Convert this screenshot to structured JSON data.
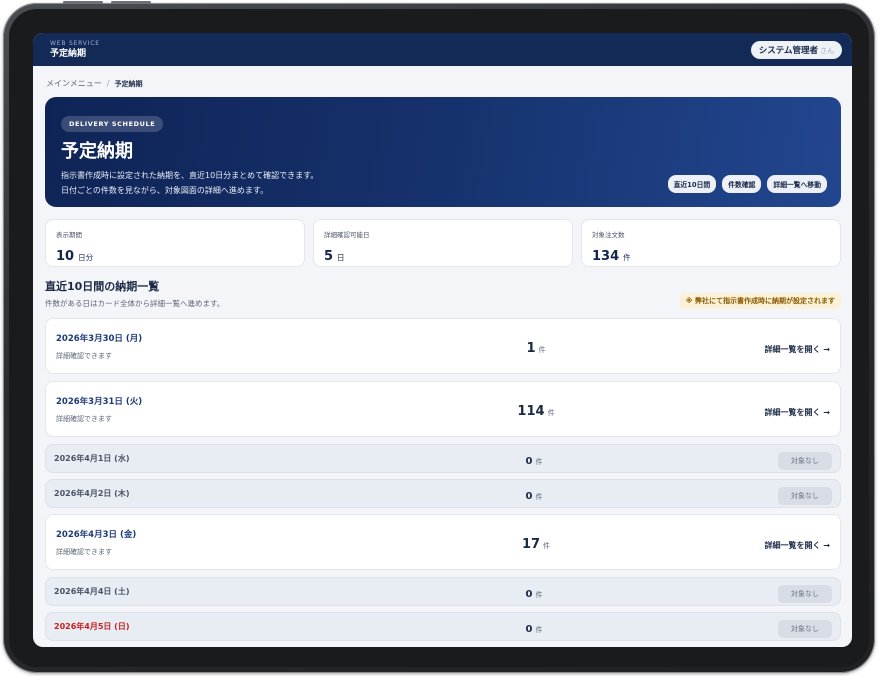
{
  "header": {
    "subtitle": "WEB SERVICE",
    "title": "予定納期",
    "user_name": "システム管理者",
    "user_suffix": "さん"
  },
  "breadcrumb": {
    "root": "メインメニュー",
    "separator": "/",
    "current": "予定納期"
  },
  "hero": {
    "tag": "DELIVERY SCHEDULE",
    "title": "予定納期",
    "desc_line1": "指示書作成時に設定された納期を、直近10日分まとめて確認できます。",
    "desc_line2": "日付ごとの件数を見ながら、対象図面の詳細へ進めます。",
    "buttons": [
      "直近10日間",
      "件数確認",
      "詳細一覧へ移動"
    ]
  },
  "stats": [
    {
      "label": "表示期間",
      "value": "10",
      "unit": "日分"
    },
    {
      "label": "詳細確認可能日",
      "value": "5",
      "unit": "日"
    },
    {
      "label": "対象注文数",
      "value": "134",
      "unit": "件"
    }
  ],
  "section": {
    "title": "直近10日間の納期一覧",
    "desc": "件数がある日はカード全体から詳細一覧へ進めます。",
    "notice": "※ 弊社にて指示書作成時に納期が設定されます"
  },
  "days": [
    {
      "date": "2026年3月30日 (月)",
      "count": "1",
      "unit": "件",
      "note": "詳細確認できます",
      "action": "詳細一覧を開く →"
    },
    {
      "date": "2026年3月31日 (火)",
      "count": "114",
      "unit": "件",
      "note": "詳細確認できます",
      "action": "詳細一覧を開く →"
    },
    {
      "date": "2026年4月1日 (水)",
      "count": "0",
      "unit": "件",
      "badge": "対象なし"
    },
    {
      "date": "2026年4月2日 (木)",
      "count": "0",
      "unit": "件",
      "badge": "対象なし"
    },
    {
      "date": "2026年4月3日 (金)",
      "count": "17",
      "unit": "件",
      "note": "詳細確認できます",
      "action": "詳細一覧を開く →"
    },
    {
      "date": "2026年4月4日 (土)",
      "count": "0",
      "unit": "件",
      "badge": "対象なし"
    },
    {
      "date": "2026年4月5日 (日)",
      "count": "0",
      "unit": "件",
      "badge": "対象なし"
    }
  ],
  "colors": {
    "header_bg": "#132a57",
    "hero_start": "#0f2456",
    "hero_end": "#22468f",
    "sunday_red": "#c62020",
    "notice_bg": "#fbf1d6"
  }
}
